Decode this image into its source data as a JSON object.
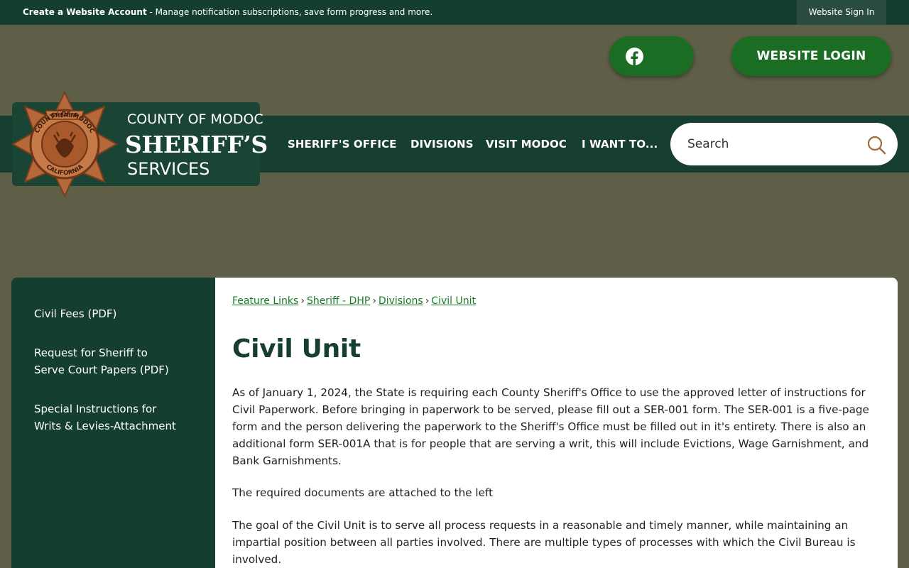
{
  "topbar": {
    "notice_bold": "Create a Website Account",
    "notice_rest": " - Manage notification subscriptions, save form progress and more.",
    "signin": "Website Sign In"
  },
  "header": {
    "login_label": "WEBSITE LOGIN",
    "logo": {
      "line1": "COUNTY OF MODOC",
      "line2": "SHERIFF’S",
      "line3": "SERVICES",
      "badge_top": "SHERIFF",
      "badge_ring": "COUNTY OF MODOC",
      "badge_bottom": "CALIFORNIA"
    },
    "search_placeholder": "Search"
  },
  "nav": {
    "items": [
      {
        "label": "SHERIFF'S OFFICE"
      },
      {
        "label": "DIVISIONS"
      },
      {
        "label": "VISIT MODOC"
      },
      {
        "label": "I WANT TO..."
      }
    ]
  },
  "sidebar": {
    "items": [
      {
        "line1": "Civil Fees (PDF)",
        "line2": ""
      },
      {
        "line1": "Request for Sheriff to",
        "line2": "Serve Court Papers (PDF)"
      },
      {
        "line1": "Special Instructions for",
        "line2": "Writs & Levies-Attachment"
      }
    ]
  },
  "main": {
    "breadcrumbs": [
      "Feature Links",
      "Sheriff - DHP",
      "Divisions",
      "Civil Unit"
    ],
    "title": "Civil Unit",
    "paragraphs": [
      "As of January 1, 2024, the State is requiring each County Sheriff's Office to use the approved letter of instructions for Civil Paperwork. Before bringing in paperwork to be served, please fill out a SER-001 form. The SER-001 is a five-page form and the person delivering the paperwork to the Sheriff's Office must be filled out in it's entirety. There is also an additional form SER-001A that is for people that are serving a writ, this will include Evictions, Wage Garnishment, and Bank Garnishments.",
      "The required documents are attached to the left",
      "The goal of the Civil Unit is to serve all process requests in a reasonable and timely manner, while maintaining an impartial position between all parties involved. There are multiple types of processes with which the Civil Bureau is involved."
    ]
  },
  "colors": {
    "dark_green": "#143f30",
    "button_green": "#1a6d22",
    "olive_bg": "#5e5f46",
    "link_green": "#1a7a2a",
    "badge_copper": "#b5683a"
  }
}
